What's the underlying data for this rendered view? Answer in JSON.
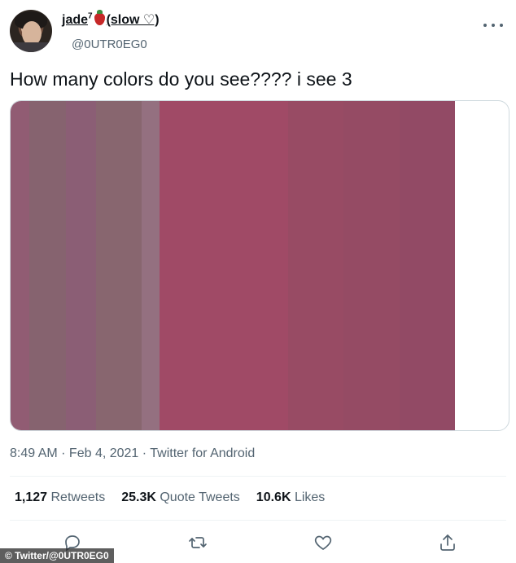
{
  "tweet": {
    "display_name": "jade",
    "name_superscript": "7",
    "name_suffix": "(slow ♡)",
    "handle": "@0UTR0EG0",
    "text": "How many colors do you see???? i see 3",
    "time": "8:49 AM",
    "date": "Feb 4, 2021",
    "source": "Twitter for Android",
    "retweets_count": "1,127",
    "retweets_label": "Retweets",
    "quote_count": "25.3K",
    "quote_label": "Quote Tweets",
    "likes_count": "10.6K",
    "likes_label": "Likes"
  },
  "media": {
    "bands": [
      {
        "color": "#915c73"
      },
      {
        "color": "#86636f"
      },
      {
        "color": "#8b5e75"
      },
      {
        "color": "#88666f"
      },
      {
        "color": "#947080"
      },
      {
        "color": "#a04a66"
      },
      {
        "color": "#984b64"
      },
      {
        "color": "#954b64"
      },
      {
        "color": "#924a65"
      }
    ]
  },
  "icons": {
    "more": "more-icon",
    "reply": "reply-icon",
    "retweet": "retweet-icon",
    "like": "heart-icon",
    "share": "share-icon",
    "emoji": "strawberry-icon"
  },
  "credit": "© Twitter/@0UTR0EG0"
}
